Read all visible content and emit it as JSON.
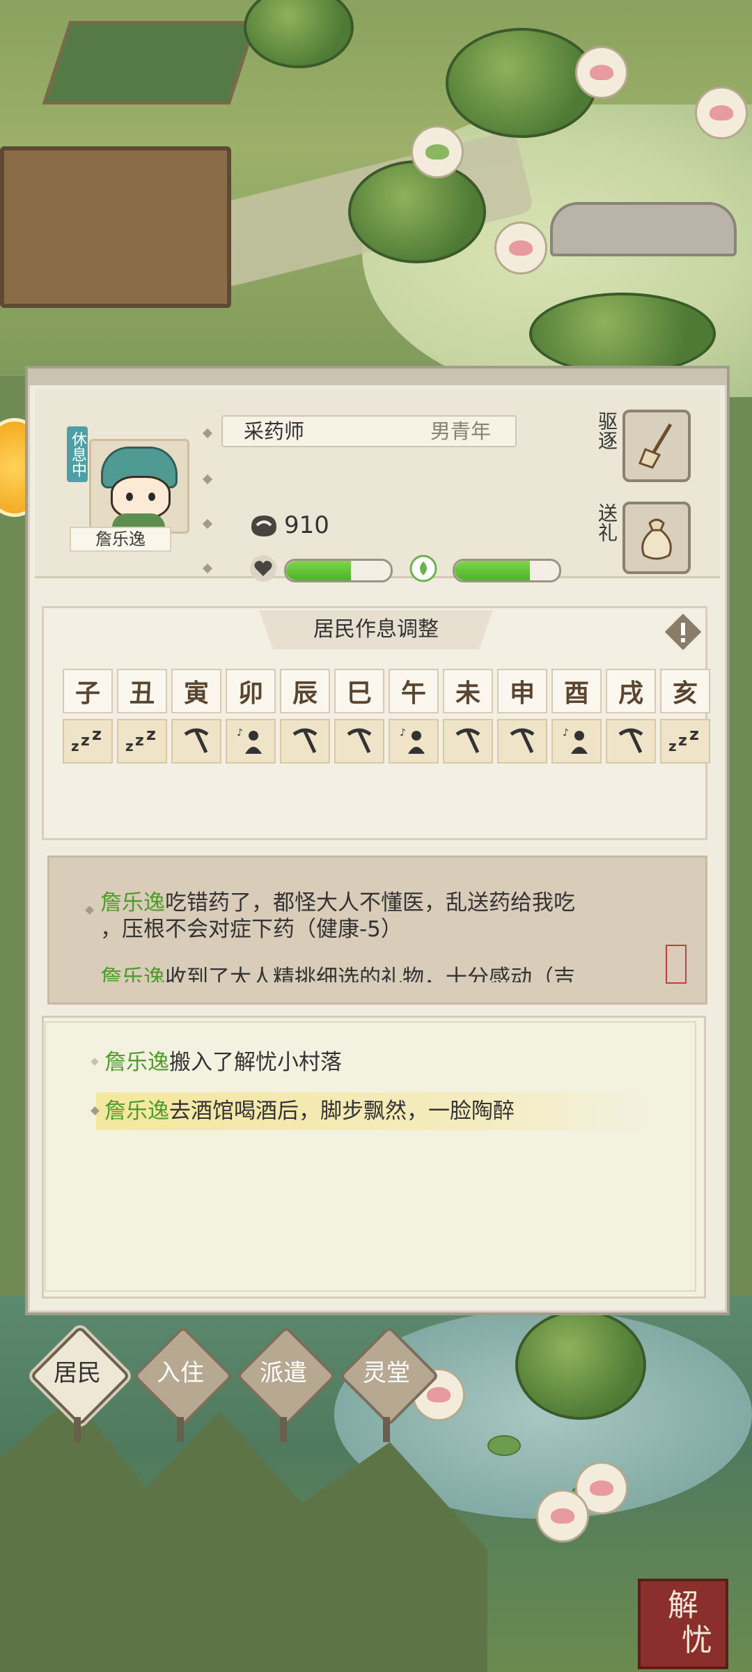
{
  "resident": {
    "status_tag": "休息中",
    "name": "詹乐逸",
    "role": "采药师",
    "gender_age": "男青年",
    "money": "910",
    "health_level": 0.62,
    "mood_level": 0.72
  },
  "actions": {
    "expel_label": "驱逐",
    "gift_label": "送礼"
  },
  "schedule": {
    "title": "居民作息调整",
    "hours": [
      "子",
      "丑",
      "寅",
      "卯",
      "辰",
      "巳",
      "午",
      "未",
      "申",
      "酉",
      "戌",
      "亥"
    ],
    "activities": [
      "sleep-icon",
      "sleep-icon",
      "pickaxe-icon",
      "leisure-icon",
      "pickaxe-icon",
      "pickaxe-icon",
      "leisure-icon",
      "pickaxe-icon",
      "pickaxe-icon",
      "leisure-icon",
      "pickaxe-icon",
      "sleep-icon"
    ]
  },
  "log_top": {
    "line1_name": "詹乐逸",
    "line1_text": "吃错药了，都怪大人不懂医，乱送药给我吃",
    "line2_text": "，压根不会对症下药（健康-5）",
    "line3_name": "詹乐逸",
    "line3_text": "收到了大人精挑细选的礼物，十分感动（吉"
  },
  "log_bottom": {
    "entry1_name": "詹乐逸",
    "entry1_text": "搬入了解忧小村落",
    "entry2_name": "詹乐逸",
    "entry2_text": "去酒馆喝酒后，脚步飘然，一脸陶醉"
  },
  "tabs": [
    "居民",
    "入住",
    "派遣",
    "灵堂"
  ],
  "logo_text": [
    "解",
    "忧"
  ],
  "colors": {
    "accent_green": "#4f9a2c",
    "bar_fill": "#5ec232",
    "status_tag": "#4fa0a6"
  }
}
